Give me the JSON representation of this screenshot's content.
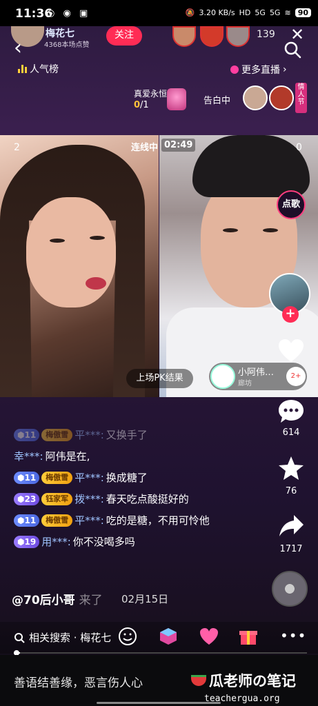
{
  "status_bar": {
    "time": "11:36",
    "net_speed": "3.20 KB/s",
    "hd": "HD",
    "sig1": "5G",
    "sig2": "5G",
    "battery": "90"
  },
  "header": {
    "host_name": "梅花七",
    "host_likes": "4368本场点赞",
    "follow_label": "关注",
    "viewer_count": "139",
    "rank_label": "人气榜",
    "more_live_label": "更多直播"
  },
  "banner": {
    "gift_task_label": "真爱永恒",
    "gift_progress_current": "0",
    "gift_progress_total": "/1",
    "confess_label": "告白中",
    "valentine_label": "情人节"
  },
  "pk": {
    "left_score": "2",
    "right_score": "0",
    "link_label": "连线中",
    "timer": "02:49",
    "result_label": "上场PK结果",
    "guest_name": "小阿伟…",
    "guest_location": "廊坊",
    "guest_badge": "2+"
  },
  "actions": {
    "song_label": "点歌",
    "comment_count": "614",
    "star_count": "76",
    "share_count": "1717"
  },
  "chat": [
    {
      "level": "11",
      "fan": "梅傲雪",
      "user": "平***:",
      "text": "又换手了",
      "faded": true
    },
    {
      "level": "",
      "fan": "",
      "user": "幸***:",
      "text": "阿伟是在,",
      "faded": false
    },
    {
      "level": "11",
      "fan": "梅傲雪",
      "user": "平***:",
      "text": "换成糖了",
      "faded": false
    },
    {
      "level": "23",
      "fan": "钰家军",
      "user": "拨***:",
      "text": "春天吃点酸挺好的",
      "faded": false
    },
    {
      "level": "11",
      "fan": "梅傲雪",
      "user": "平***:",
      "text": "吃的是糖，不用可怜他",
      "faded": false
    },
    {
      "level": "19",
      "fan": "",
      "user": "用***:",
      "text": "你不没喝多吗",
      "faded": false
    }
  ],
  "mention": {
    "text": "@70后小哥",
    "behind": "来了",
    "date": "02月15日"
  },
  "bottom_bar": {
    "related_search": "相关搜索 · 梅花七"
  },
  "footer": {
    "motto": "善语结善缘，恶言伤人心",
    "watermark": "瓜老师の笔记",
    "site": "teachergua.org"
  },
  "colors": {
    "accent": "#ff2c55",
    "username": "#9fc4ff",
    "fan_badge": "#ffcc3a",
    "level_badge": "#6d8cff"
  }
}
